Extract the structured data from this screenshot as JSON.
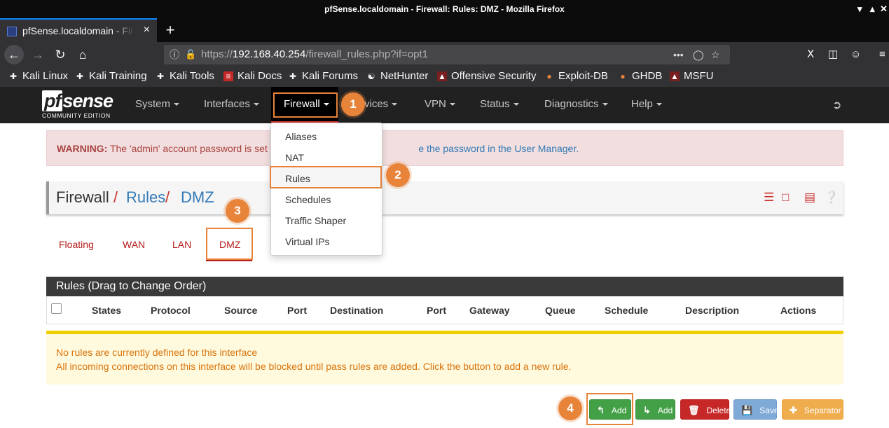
{
  "window": {
    "title": "pfSense.localdomain - Firewall: Rules: DMZ - Mozilla Firefox",
    "controls": [
      "▾",
      "▴",
      "✕"
    ]
  },
  "browser": {
    "tab_title": "pfSense.localdomain - Firewall: Rules: DMZ",
    "tab_close": "×",
    "new_tab": "+",
    "url_base": "https://",
    "url_host": "192.168.40.254",
    "url_path": "/firewall_rules.php?if=opt1",
    "bookmarks": [
      "Kali Linux",
      "Kali Training",
      "Kali Tools",
      "Kali Docs",
      "Kali Forums",
      "NetHunter",
      "Offensive Security",
      "Exploit-DB",
      "GHDB",
      "MSFU"
    ]
  },
  "pfsense": {
    "logo_main": "sense",
    "logo_pf": "pf",
    "logo_sub": "COMMUNITY EDITION",
    "menu": [
      "System",
      "Interfaces",
      "Firewall",
      "Services",
      "VPN",
      "Status",
      "Diagnostics",
      "Help"
    ],
    "menu_services_visible": "vices",
    "firewall_dropdown": [
      "Aliases",
      "NAT",
      "Rules",
      "Schedules",
      "Traffic Shaper",
      "Virtual IPs"
    ]
  },
  "warning": {
    "label": "WARNING:",
    "text_before": " The 'admin' account password is set to",
    "link_tail": "e the password in the User Manager."
  },
  "breadcrumb": {
    "root": "Firewall",
    "sep": "/",
    "level2": "Rules",
    "level3": "DMZ"
  },
  "tabs": [
    "Floating",
    "WAN",
    "LAN",
    "DMZ"
  ],
  "rules_panel": {
    "heading": "Rules (Drag to Change Order)",
    "columns": [
      "States",
      "Protocol",
      "Source",
      "Port",
      "Destination",
      "Port",
      "Gateway",
      "Queue",
      "Schedule",
      "Description",
      "Actions"
    ],
    "notice_line1": "No rules are currently defined for this interface",
    "notice_line2": "All incoming connections on this interface will be blocked until pass rules are added. Click the button to add a new rule."
  },
  "buttons": {
    "add_top": "Add",
    "add_bottom": "Add",
    "delete": "Delete",
    "save": "Save",
    "separator": "Separator"
  },
  "annotations": [
    "1",
    "2",
    "3",
    "4"
  ],
  "colors": {
    "annotation": "#e8833a",
    "pfsense_red": "#b71c1c",
    "nav_bg": "#212121",
    "warning_bg": "#f2dede",
    "notice_bg": "#fffadd"
  }
}
